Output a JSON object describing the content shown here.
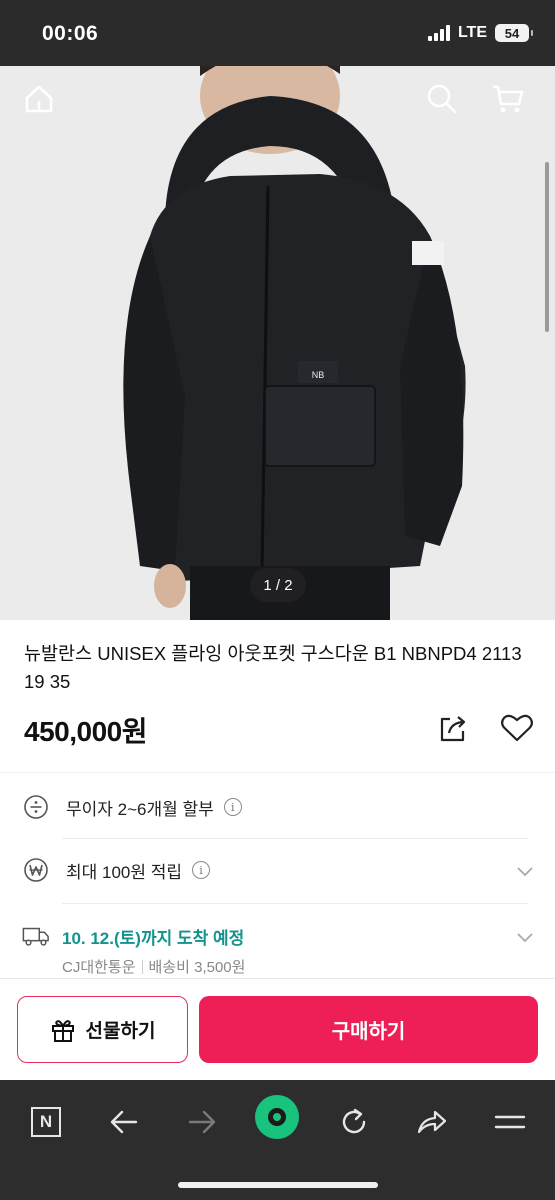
{
  "status": {
    "time": "00:06",
    "network": "LTE",
    "battery": "54"
  },
  "hero": {
    "image_counter": "1 / 2"
  },
  "product": {
    "title": "뉴발란스 UNISEX 플라잉 아웃포켓 구스다운 B1 NBNPD4 2113 19 35",
    "price": "450,000원"
  },
  "info": {
    "installment": "무이자 2~6개월 할부",
    "points": "최대 100원 적립",
    "delivery": "10. 12.(토)까지 도착 예정",
    "carrier": "CJ대한통운",
    "shipping_fee": "배송비 3,500원"
  },
  "cta": {
    "gift_label": "선물하기",
    "buy_label": "구매하기"
  },
  "toolbar": {
    "n_label": "N"
  },
  "colors": {
    "accent": "#ee1f57",
    "delivery": "#14928e",
    "toolbar": "#2d2d2d",
    "green_button": "#19c37d"
  }
}
